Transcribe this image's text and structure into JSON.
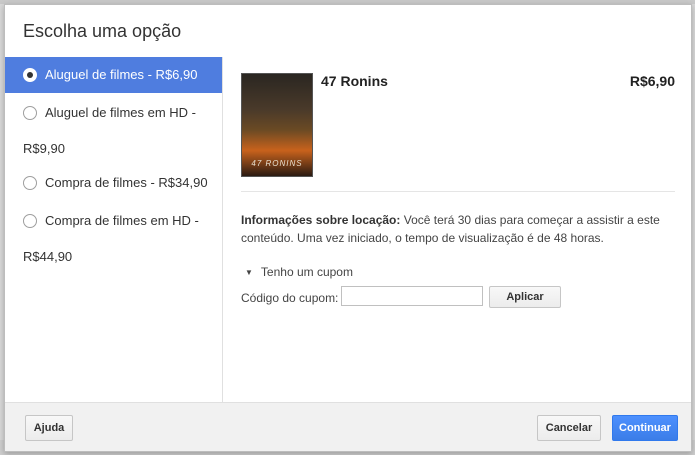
{
  "dialog": {
    "title": "Escolha uma opção"
  },
  "options": [
    {
      "line1": "Aluguel de filmes - R$6,90",
      "line2": "",
      "selected": true
    },
    {
      "line1": "Aluguel de filmes em HD -",
      "line2": "R$9,90",
      "selected": false
    },
    {
      "line1": "Compra de filmes - R$34,90",
      "line2": "",
      "selected": false
    },
    {
      "line1": "Compra de filmes em HD -",
      "line2": "R$44,90",
      "selected": false
    }
  ],
  "movie": {
    "title": "47 Ronins",
    "price": "R$6,90",
    "poster_text": "47 RONINS"
  },
  "info": {
    "label": "Informações sobre locação:",
    "text": " Você terá 30 dias para começar a assistir a este conteúdo. Uma vez iniciado, o tempo de visualização é de 48 horas."
  },
  "coupon": {
    "toggle_label": "Tenho um cupom",
    "field_label": "Código do cupom:",
    "value": "",
    "apply_label": "Aplicar"
  },
  "footer": {
    "help_label": "Ajuda",
    "cancel_label": "Cancelar",
    "continue_label": "Continuar"
  },
  "colors": {
    "selected_bg": "#4f7ddf",
    "primary_button": "#4d90fe"
  }
}
